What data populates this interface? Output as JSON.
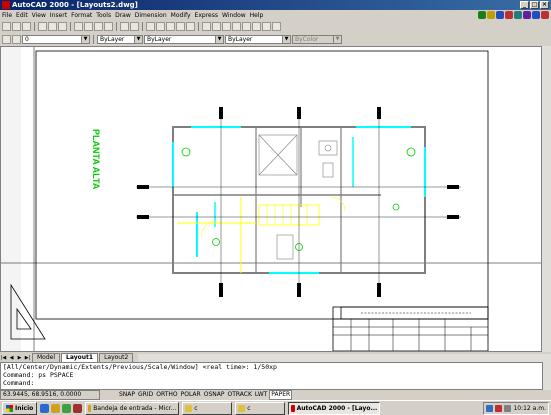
{
  "window": {
    "title": "AutoCAD 2000 - [Layouts2.dwg]"
  },
  "menu": [
    "File",
    "Edit",
    "View",
    "Insert",
    "Format",
    "Tools",
    "Draw",
    "Dimension",
    "Modify",
    "Express",
    "Window",
    "Help"
  ],
  "properties": {
    "layer_value": "0",
    "color_value": "ByLayer",
    "linetype_value": "ByLayer",
    "lineweight_value": "ByLayer",
    "plotstyle_value": "ByColor"
  },
  "drawing": {
    "vertical_label": "PLANTA ALTA"
  },
  "layout_tabs": [
    "Model",
    "Layout1",
    "Layout2"
  ],
  "active_tab": "Layout1",
  "command_lines": [
    "[All/Center/Dynamic/Extents/Previous/Scale/Window] <real time>: 1/50xp",
    "Command: ps PSPACE",
    "Command:"
  ],
  "status": {
    "coordinates": "63.9445,  68.9516, 0.0000",
    "toggles": [
      "SNAP",
      "GRID",
      "ORTHO",
      "POLAR",
      "OSNAP",
      "OTRACK",
      "LWT",
      "PAPER"
    ]
  },
  "taskbar": {
    "start": "Inicio",
    "buttons": [
      "Bandeja de entrada - Micr...",
      "c",
      "c",
      "AutoCAD 2000 - [Layo..."
    ],
    "clock": "10:12 a.m."
  },
  "colors": {
    "title_bar": "#0a246a",
    "plan_walls": "#7f7f7f",
    "plan_detail": "#ffff00",
    "plan_windows": "#00ffff",
    "plan_labels": "#00cc00"
  }
}
